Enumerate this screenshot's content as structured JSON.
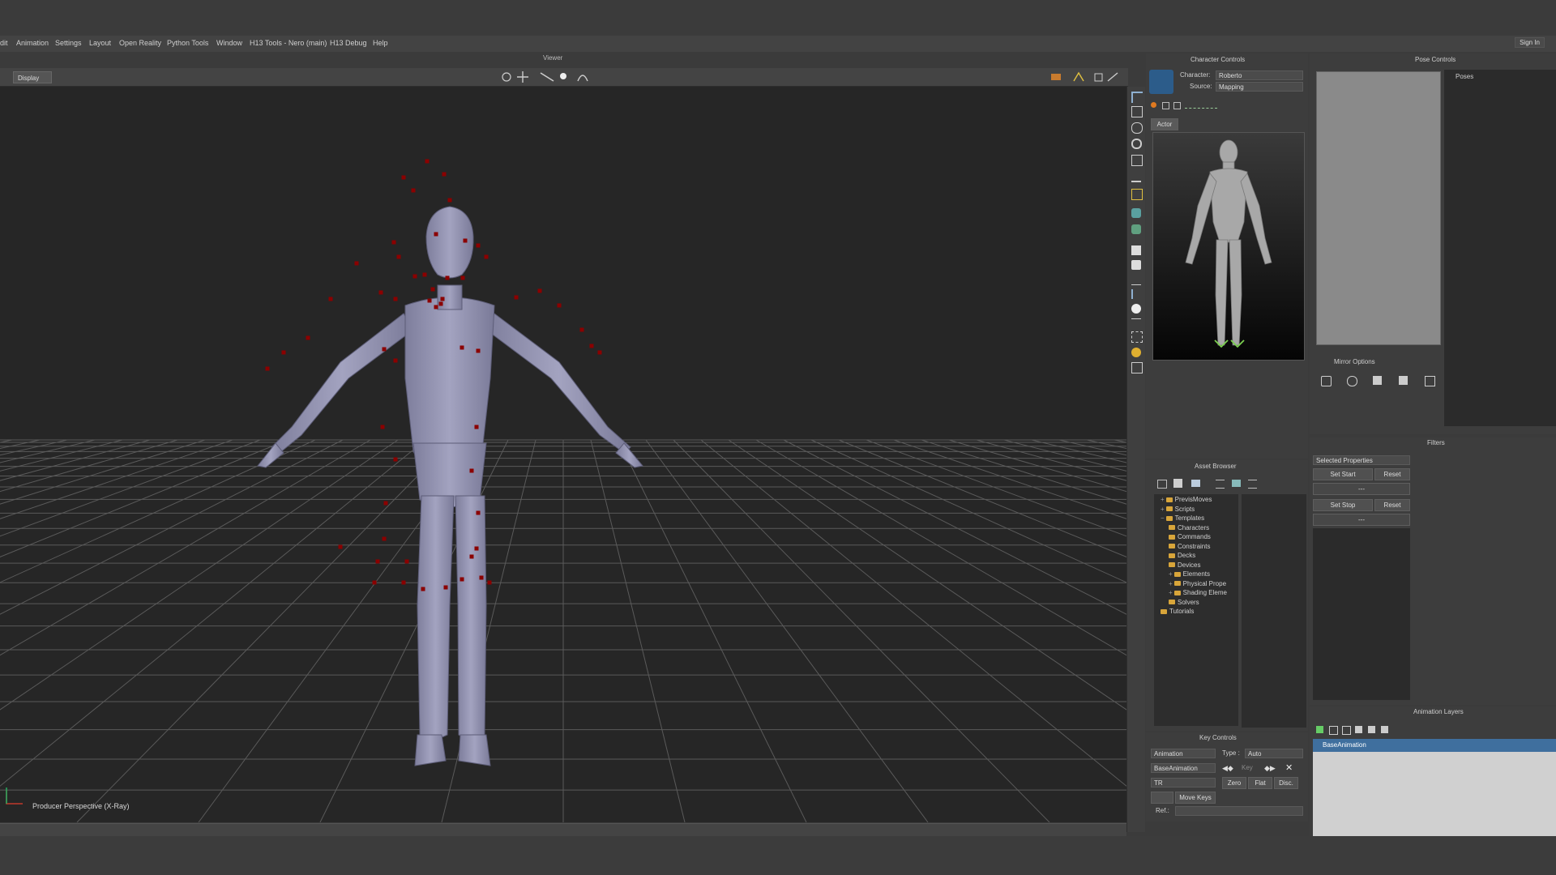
{
  "menu": [
    "dit",
    "Animation",
    "Settings",
    "Layout",
    "Open Reality",
    "Python Tools",
    "Window",
    "H13 Tools - Nero (main)",
    "H13 Debug",
    "Help"
  ],
  "signin": "Sign In",
  "viewer": {
    "title": "Viewer",
    "display_btn": "Display",
    "camera_label": "Producer Perspective (X-Ray)"
  },
  "character_controls": {
    "title": "Character Controls",
    "character_label": "Character:",
    "character_value": "Roberto",
    "source_label": "Source:",
    "source_value": "Mapping",
    "tab": "Actor"
  },
  "pose_controls": {
    "title": "Pose Controls",
    "poses_label": "Poses",
    "mirror_options": "Mirror Options"
  },
  "filters": {
    "title": "Filters",
    "dropdown": "Selected Properties",
    "set_start": "Set Start",
    "reset1": "Reset",
    "start_value": "---",
    "set_stop": "Set Stop",
    "reset2": "Reset",
    "stop_value": "---"
  },
  "asset_browser": {
    "title": "Asset Browser",
    "tree": [
      {
        "label": "PrevisMoves",
        "indent": 0,
        "expander": "+"
      },
      {
        "label": "Scripts",
        "indent": 0,
        "expander": "+"
      },
      {
        "label": "Templates",
        "indent": 0,
        "expander": "−"
      },
      {
        "label": "Characters",
        "indent": 1,
        "expander": ""
      },
      {
        "label": "Commands",
        "indent": 1,
        "expander": ""
      },
      {
        "label": "Constraints",
        "indent": 1,
        "expander": ""
      },
      {
        "label": "Decks",
        "indent": 1,
        "expander": ""
      },
      {
        "label": "Devices",
        "indent": 1,
        "expander": ""
      },
      {
        "label": "Elements",
        "indent": 1,
        "expander": "+"
      },
      {
        "label": "Physical Prope",
        "indent": 1,
        "expander": "+"
      },
      {
        "label": "Shading Eleme",
        "indent": 1,
        "expander": "+"
      },
      {
        "label": "Solvers",
        "indent": 1,
        "expander": ""
      },
      {
        "label": "Tutorials",
        "indent": 0,
        "expander": ""
      }
    ]
  },
  "key_controls": {
    "title": "Key Controls",
    "animation": "Animation",
    "type_label": "Type :",
    "type_value": "Auto",
    "layer": "BaseAnimation",
    "key_label": "Key",
    "tr": "TR",
    "zero": "Zero",
    "flat": "Flat",
    "disc": "Disc.",
    "move_keys": "Move Keys",
    "ref_label": "Ref.:"
  },
  "animation_layers": {
    "title": "Animation Layers",
    "layer": "BaseAnimation"
  },
  "colors": {
    "accent": "#3f6f9e",
    "marker": "#8b0000",
    "mannequin": "#9a9ab8"
  }
}
